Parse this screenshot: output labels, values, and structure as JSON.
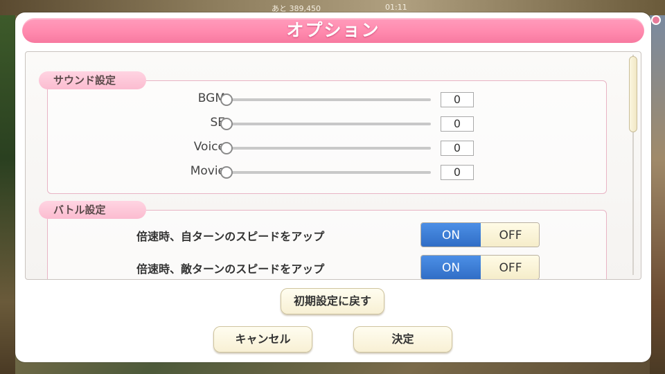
{
  "background": {
    "top_text": "あと 389,450",
    "time": "01:11"
  },
  "dialog": {
    "title": "オプション"
  },
  "sound_section": {
    "label": "サウンド設定",
    "sliders": [
      {
        "label": "BGM",
        "value": "0",
        "level": 0
      },
      {
        "label": "SE",
        "value": "0",
        "level": 0
      },
      {
        "label": "Voice",
        "value": "0",
        "level": 0
      },
      {
        "label": "Movie",
        "value": "0",
        "level": 0
      }
    ]
  },
  "battle_section": {
    "label": "バトル設定",
    "toggles": [
      {
        "label": "倍速時、自ターンのスピードをアップ",
        "on": "ON",
        "off": "OFF",
        "selected": "ON"
      },
      {
        "label": "倍速時、敵ターンのスピードをアップ",
        "on": "ON",
        "off": "OFF",
        "selected": "ON"
      }
    ]
  },
  "buttons": {
    "reset": "初期設定に戻す",
    "cancel": "キャンセル",
    "confirm": "決定"
  },
  "colors": {
    "title_pink": "#ff8aae",
    "on_blue": "#2f6cc4",
    "section_pink": "#fbbcd0"
  }
}
